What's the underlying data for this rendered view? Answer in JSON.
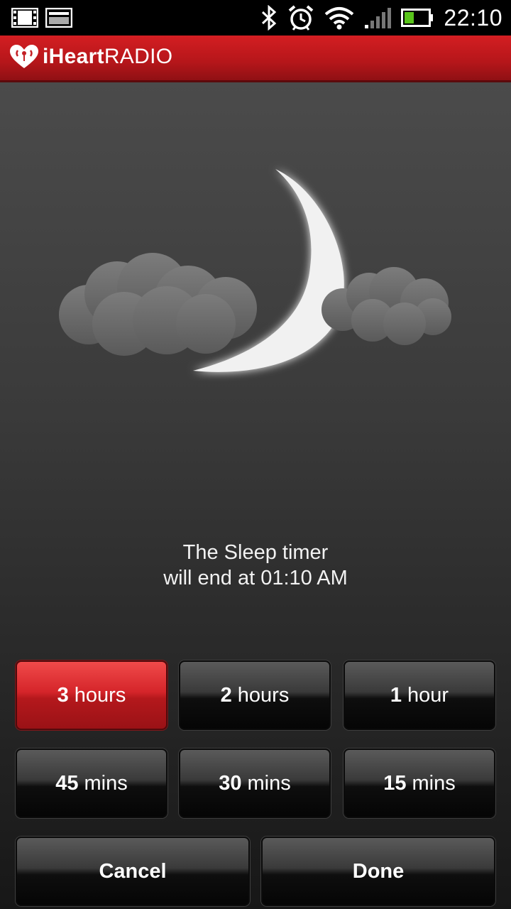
{
  "status_bar": {
    "time": "22:10",
    "icons": [
      "film-strip-icon",
      "image-icon",
      "bluetooth-icon",
      "alarm-icon",
      "wifi-icon",
      "signal-icon",
      "battery-icon"
    ]
  },
  "app": {
    "logo_bold": "iHeart",
    "logo_regular": "RADIO"
  },
  "illustration": {
    "icons": [
      "moon-icon",
      "cloud-icon"
    ]
  },
  "message": {
    "line1": "The Sleep timer",
    "line2": "will end at 01:10 AM"
  },
  "timer_options": [
    {
      "num": "3",
      "unit": "hours",
      "selected": true
    },
    {
      "num": "2",
      "unit": "hours",
      "selected": false
    },
    {
      "num": "1",
      "unit": "hour",
      "selected": false
    },
    {
      "num": "45",
      "unit": "mins",
      "selected": false
    },
    {
      "num": "30",
      "unit": "mins",
      "selected": false
    },
    {
      "num": "15",
      "unit": "mins",
      "selected": false
    }
  ],
  "actions": {
    "cancel": "Cancel",
    "done": "Done"
  },
  "colors": {
    "accent": "#d41e22",
    "selected_button": "#c41f24",
    "battery_level": "#59c41b"
  }
}
